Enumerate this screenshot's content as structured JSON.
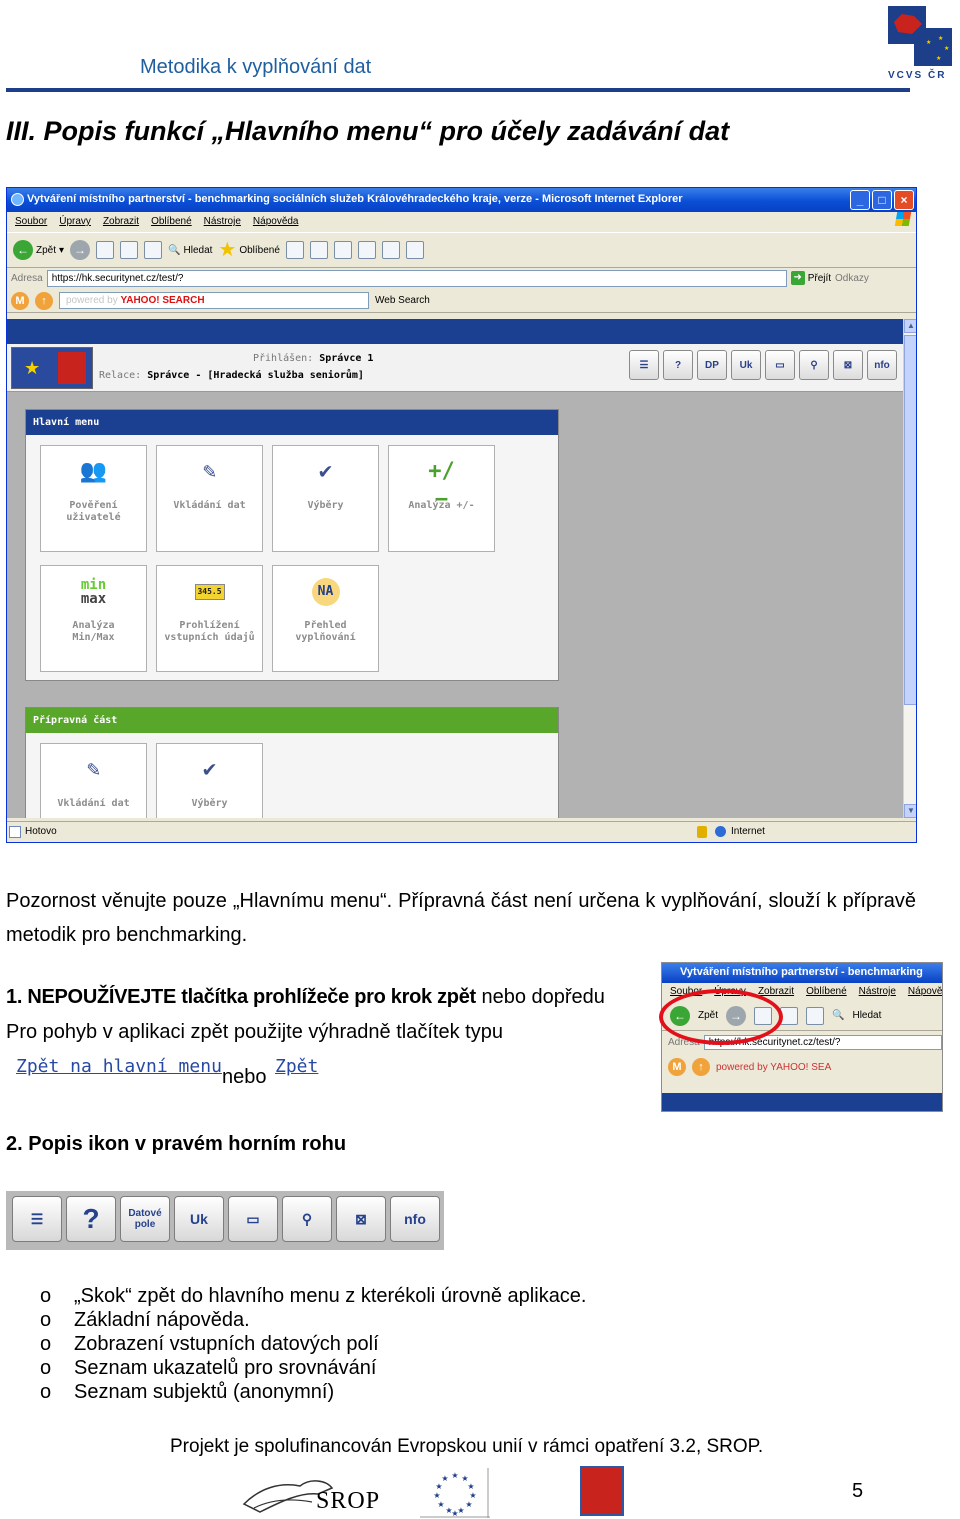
{
  "header": {
    "title": "Metodika k vyplňování dat",
    "logo_text": "VCVS ČR"
  },
  "section_title": "III. Popis funkcí „Hlavního menu“ pro účely zadávání dat",
  "browser": {
    "title": "Vytváření místního partnerství - benchmarking sociálních služeb Královéhradeckého kraje, verze - Microsoft Internet Explorer",
    "menu": [
      "Soubor",
      "Úpravy",
      "Zobrazit",
      "Oblíbené",
      "Nástroje",
      "Nápověda"
    ],
    "toolbar": {
      "back": "Zpět",
      "search": "Hledat",
      "favorites": "Oblíbené"
    },
    "address_label": "Adresa",
    "address_value": "https://hk.securitynet.cz/test/?",
    "go": "Přejít",
    "links": "Odkazy",
    "yahoo_powered": "powered by",
    "yahoo_brand": "YAHOO! SEARCH",
    "web_search": "Web Search",
    "status_left": "Hotovo",
    "status_zone": "Internet"
  },
  "app": {
    "logged_label": "Přihlášen:",
    "logged_user": "Správce 1",
    "session_label": "Relace:",
    "session_value": "Správce - [Hradecká služba seniorům]",
    "icons": [
      "list-icon",
      "help-icon",
      "datove-pole",
      "Uk",
      "blank-window-icon",
      "search-person-icon",
      "close-box-icon",
      "nfo"
    ],
    "main_menu": {
      "title": "Hlavní menu",
      "tiles": [
        {
          "line1": "Pověření",
          "line2": "uživatelé",
          "icon": "users-icon"
        },
        {
          "line1": "Vkládání dat",
          "line2": "",
          "icon": "pen-input-icon"
        },
        {
          "line1": "Výběry",
          "line2": "",
          "icon": "checkmark-icon"
        },
        {
          "line1": "Analýza +/-",
          "line2": "",
          "icon": "plus-minus-icon"
        },
        {
          "line1": "Analýza",
          "line2": "Min/Max",
          "icon": "min-max-icon",
          "icon_text_a": "min",
          "icon_text_b": "max"
        },
        {
          "line1": "Prohlížení",
          "line2": "vstupních údajů",
          "icon": "value-view-icon",
          "icon_text": "345.5"
        },
        {
          "line1": "Přehled",
          "line2": "vyplňování",
          "icon": "na-icon",
          "icon_text": "NA"
        }
      ]
    },
    "prep": {
      "title": "Přípravná část",
      "tiles": [
        {
          "line1": "Vkládání dat",
          "icon": "pen-input-icon"
        },
        {
          "line1": "Výběry",
          "icon": "checkmark-icon"
        }
      ]
    }
  },
  "body": {
    "paragraph": "Pozornost věnujte pouze „Hlavnímu menu“. Přípravná část není určena k vyplňování, slouží k přípravě metodik pro benchmarking.",
    "step1_bold": "1. NEPOUŽÍVEJTE tlačítka prohlížeče pro krok zpět",
    "step1_rest": " nebo dopředu",
    "step1_line2": "Pro pohyb v aplikaci zpět použijte výhradně tlačítek typu",
    "link_home": "Zpět na hlavní menu",
    "nebo": "nebo",
    "link_back": "Zpět",
    "step2": "2. Popis ikon v pravém horním rohu",
    "excerpt": {
      "title": "Vytváření místního partnerství - benchmarking",
      "menu": [
        "Soubor",
        "Úpravy",
        "Zobrazit",
        "Oblíbené",
        "Nástroje",
        "Nápově"
      ],
      "back": "Zpět",
      "search": "Hledat",
      "address_label": "Adresa",
      "address_value": "https://hk.securitynet.cz/test/?",
      "yahoo": "powered by YAHOO! SEA"
    },
    "icon_strip": [
      "list-icon",
      "help-icon",
      "Datové pole",
      "Uk",
      "blank-window-icon",
      "search-person-icon",
      "close-box-icon",
      "nfo"
    ],
    "bullets": [
      "„Skok“ zpět do hlavního menu z kterékoli úrovně aplikace.",
      "Základní nápověda.",
      "Zobrazení vstupních datových polí",
      "Seznam ukazatelů pro srovnávání",
      "Seznam subjektů (anonymní)"
    ],
    "bullet_marker": "o"
  },
  "footer": {
    "text": "Projekt je spolufinancován Evropskou unií v rámci opatření 3.2, SROP.",
    "srop": "SROP",
    "page": "5"
  },
  "colors": {
    "header_blue": "#1f5fa0",
    "rule": "#1d3f8a",
    "app_blue": "#1b3f91",
    "prep_green": "#58a72b",
    "highlight_red": "#e3101b"
  }
}
